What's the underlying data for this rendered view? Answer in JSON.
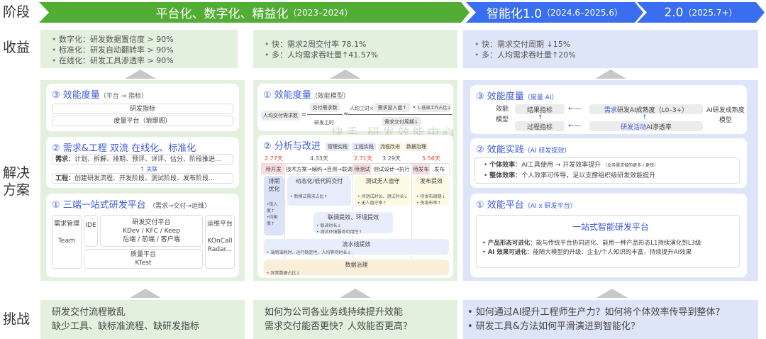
{
  "row_labels": {
    "stage": "阶段",
    "benefit": "收益",
    "solution": "解决方案",
    "challenge": "挑战"
  },
  "stages": [
    {
      "title": "平台化、数字化、精益化",
      "period": "（2023–2024）",
      "color": "#52ad35"
    },
    {
      "title": "智能化1.0",
      "period": "（2024.6–2025.6）",
      "color": "#3a6ef0"
    },
    {
      "title": "2.0",
      "period": "（2025.7+）",
      "color": "#3a6ef0"
    }
  ],
  "benefits": [
    [
      "数字化：研发数据置信度 > 90%",
      "标准化：研发自动翻转率 > 90%",
      "在线化：研发工具渗透率 > 90%"
    ],
    [
      "快：需求2周交付率 78.1%",
      "多：人均需求吞吐量↑41.57%"
    ],
    [
      "快：需求交付周期 ↓15%",
      "多：人均需求吞吐量↑20%"
    ]
  ],
  "col1": {
    "metrics": {
      "title": "③ 效能度量",
      "sub": "（平台 → 指标）",
      "items": [
        "研发指标",
        "度量平台（琅琊阁）"
      ]
    },
    "dual": {
      "title": "② 需求&工程 双流 在线化、标准化",
      "req_label": "需求：",
      "req": "计划、拆解、排期、预评、详评、估分、阶段推进...",
      "link": "关联",
      "eng_label": "工程：",
      "eng": "创建研发流程、开发阶段、测试阶段、发布阶段..."
    },
    "platform": {
      "title": "① 三端一站式研发平台",
      "sub": "（需求→交付→运维）",
      "req": "需求管理",
      "req2": "Team",
      "ide": "IDE",
      "delivery": "研发交付平台",
      "delivery2": "KDev / KFC / Keep",
      "delivery3": "后端  / 前端 / 客户端",
      "quality": "质量平台",
      "quality2": "KTest",
      "ops": "运维平台",
      "ops2": "KOnCall",
      "ops3": "Radar..."
    }
  },
  "col2": {
    "metrics": {
      "title": "① 效能度量",
      "sub": "（效能模型）",
      "lhs": "人均交付需求数",
      "eq": "=",
      "num": "交付需求数",
      "den": "研发工时",
      "approx": "≈",
      "f1": "人均工时×",
      "f2": "需求投入度↑",
      "x": "×",
      "f3": "1-低效工作占比↓",
      "f4": "需求交付周期↓"
    },
    "watermark": "快手 研发效能中心",
    "analysis": {
      "title": "② 分析与改进",
      "tags": [
        "管理实践",
        "工程实践",
        "流程改进",
        "数据治理"
      ],
      "days": [
        "2.77天",
        "4.33天",
        "2.71天",
        "3.29天",
        "5.56天"
      ],
      "stages": [
        "待开发",
        "技术方案→编码→自测→联调",
        "待测试",
        "测试设计→执行",
        "待发布",
        "发布"
      ],
      "b1": {
        "t": "排期优化",
        "i": [
          "•投入度↑",
          "•均衡度↑"
        ]
      },
      "b2": {
        "t": "动态化/低代码交付",
        "i": [
          "• 新模式需求占比↑"
        ]
      },
      "b3": {
        "t": "测试无人值守",
        "i": [
          "• 待测试时长、测试时长↓",
          "• 无人值守率↑"
        ]
      },
      "b4": {
        "t": "发布提效",
        "i": [
          "• 待发布周期↓",
          "• 免发布率↑"
        ]
      },
      "b5": {
        "t": "联调提效、环境提效",
        "i": [
          "• 联调时长↓",
          "• 测试环境服务可用性↑"
        ]
      },
      "b6": {
        "t": "流水线提效",
        "i": [
          "• 端到端耗时、运行稳定性、人均等待时长↓"
        ]
      },
      "b7": {
        "t": "数据治理",
        "i": [
          "• 异常数据占比↓"
        ]
      }
    }
  },
  "col3": {
    "metrics": {
      "title": "③ 效能度量",
      "sub": "（度量 AI）",
      "left": "效能\n模型",
      "result": "结果指标",
      "process": "过程指标",
      "req_hl": "需求",
      "req": " 研发AI成熟度（L0–3+）",
      "act_hl": "研发活动",
      "act": " AI渗透率",
      "right": "AI研发成熟度\n模型"
    },
    "practice": {
      "title": "② 效能实践",
      "sub": "（AI 研发提效）",
      "i1b": "个体效率",
      "i1": "：AI工具使用 → 开发效率提升",
      "i1s": "（业务需求做的更多 / 更快）",
      "i2b": "整体效率",
      "i2": "：个人效率可传导，足以支撑组织级研发效能提升"
    },
    "platform": {
      "title": "① 效能平台",
      "sub": "（AI x 研发平台）",
      "head": "一站式智能研发平台",
      "i1b": "产品形态可进化",
      "i1": "：能与传统平台协同进化、能用一种产品形态L1持续演化到L3级",
      "i2b": "AI 效果可进化",
      "i2": "：能随大模型的升级、企业/个人知识的丰富，持续提升AI效果"
    }
  },
  "challenges": [
    [
      "研发交付流程散乱",
      "缺少工具、缺标准流程、缺研发指标"
    ],
    [
      "如何为公司各业务线持续提升效能",
      "需求交付能否更快？人效能否更高？"
    ],
    [
      "• 如何通过AI提升工程师生产力？如何将个体效率传导到整体？",
      "• 研发工具&方法如何平滑演进到智能化？"
    ]
  ]
}
